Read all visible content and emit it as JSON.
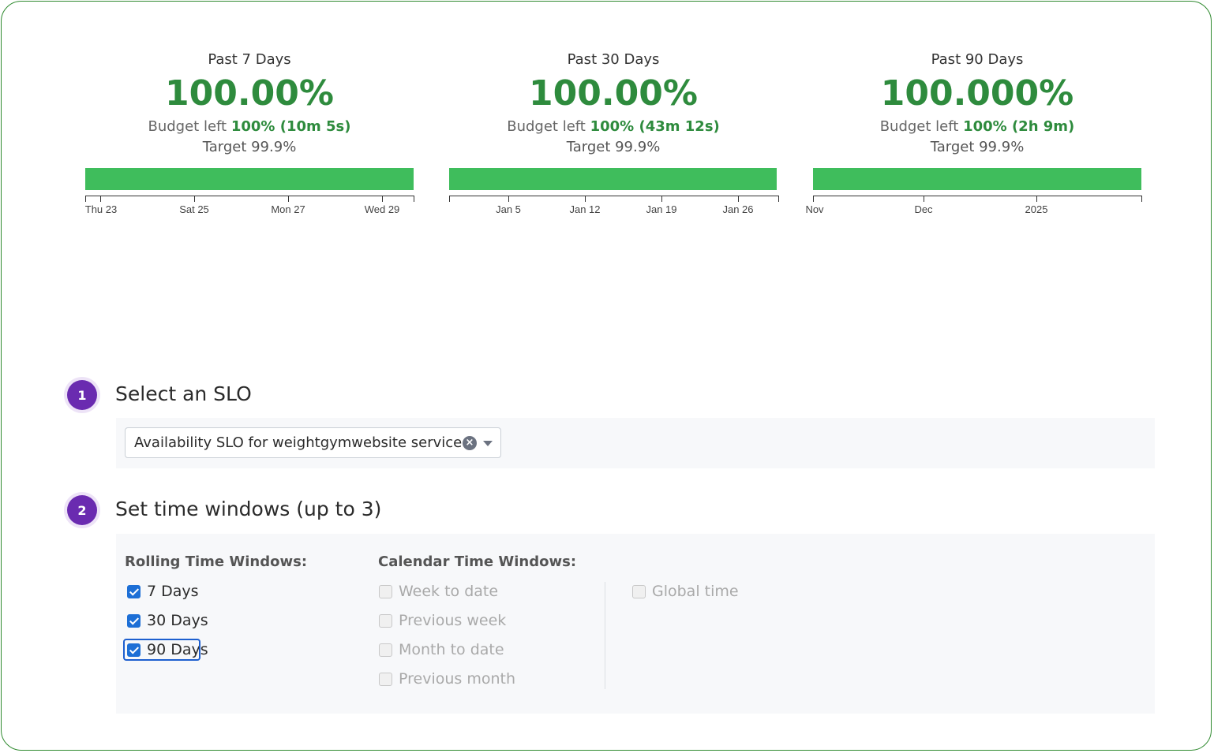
{
  "colors": {
    "success": "#2e8b3d",
    "bar": "#3fbd5c",
    "step_badge": "#6a2bb0",
    "checkbox_checked": "#1d6fd6",
    "frame_border": "#2f8a2f"
  },
  "panels": [
    {
      "period": "Past 7 Days",
      "percentage": "100.00%",
      "budget_label": "Budget left",
      "budget_value": "100% (10m 5s)",
      "target_label": "Target",
      "target_value": "99.9%",
      "ticks": [
        "Thu 23",
        "Sat 25",
        "Mon 27",
        "Wed 29"
      ]
    },
    {
      "period": "Past 30 Days",
      "percentage": "100.00%",
      "budget_label": "Budget left",
      "budget_value": "100% (43m 12s)",
      "target_label": "Target",
      "target_value": "99.9%",
      "ticks": [
        "Jan 5",
        "Jan 12",
        "Jan 19",
        "Jan 26"
      ]
    },
    {
      "period": "Past 90 Days",
      "percentage": "100.000%",
      "budget_label": "Budget left",
      "budget_value": "100% (2h 9m)",
      "target_label": "Target",
      "target_value": "99.9%",
      "ticks": [
        "Nov",
        "Dec",
        "2025"
      ]
    }
  ],
  "step1": {
    "number": "1",
    "title": "Select an SLO",
    "selected": "Availability SLO for weightgymwebsite service",
    "clear_icon": "clear-circle-icon",
    "dropdown_icon": "chevron-down-icon"
  },
  "step2": {
    "number": "2",
    "title": "Set time windows (up to 3)",
    "rolling_label": "Rolling Time Windows:",
    "rolling": [
      {
        "label": "7 Days",
        "checked": true
      },
      {
        "label": "30 Days",
        "checked": true
      },
      {
        "label": "90 Days",
        "checked": true
      }
    ],
    "calendar_label": "Calendar Time Windows:",
    "calendar": [
      {
        "label": "Week to date",
        "checked": false
      },
      {
        "label": "Previous week",
        "checked": false
      },
      {
        "label": "Month to date",
        "checked": false
      },
      {
        "label": "Previous month",
        "checked": false
      }
    ],
    "global": {
      "label": "Global time",
      "checked": false
    }
  }
}
